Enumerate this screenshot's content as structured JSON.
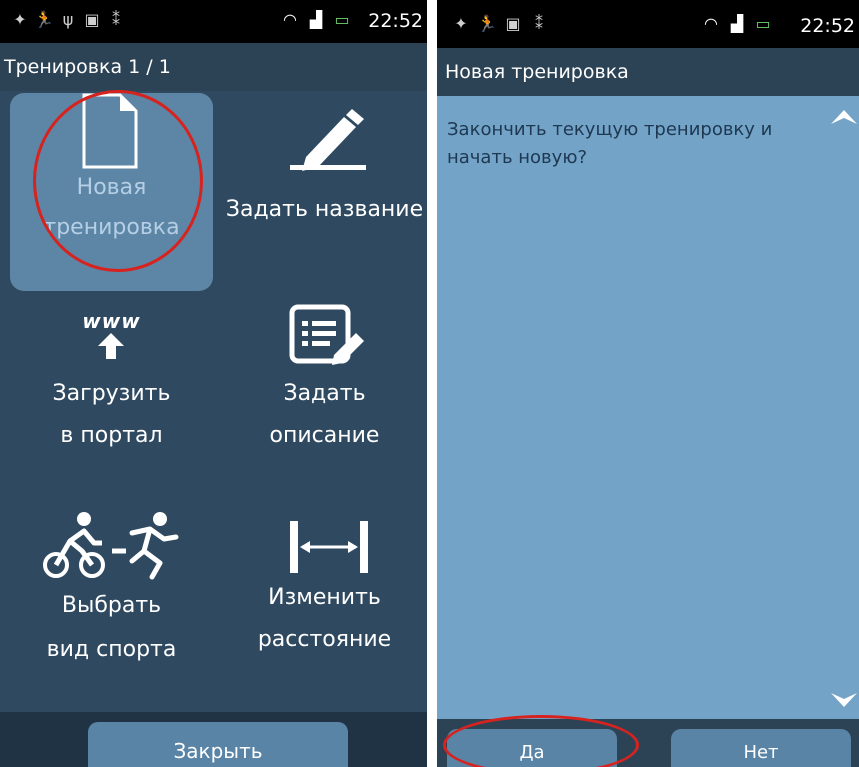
{
  "left": {
    "status_time": "22:52",
    "title": "Тренировка 1 / 1",
    "tiles": [
      {
        "line1": "Новая",
        "line2": "тренировка"
      },
      {
        "line1": "Задать название",
        "line2": ""
      },
      {
        "line1": "Загрузить",
        "line2": "в портал"
      },
      {
        "line1": "Задать",
        "line2": "описание"
      },
      {
        "line1": "Выбрать",
        "line2": "вид спорта"
      },
      {
        "line1": "Изменить",
        "line2": "расстояние"
      }
    ],
    "www_text": "www",
    "close_label": "Закрыть"
  },
  "right": {
    "status_time": "22:52",
    "title": "Новая тренировка",
    "message": "Закончить текущую тренировку и начать новую?",
    "yes_label": "Да",
    "no_label": "Нет"
  },
  "colors": {
    "background": "#2c4356",
    "tile_selected": "#5d86a6",
    "dialog_body": "#74a3c8",
    "button": "#5a84a5",
    "highlight_ring": "#d6231f"
  }
}
